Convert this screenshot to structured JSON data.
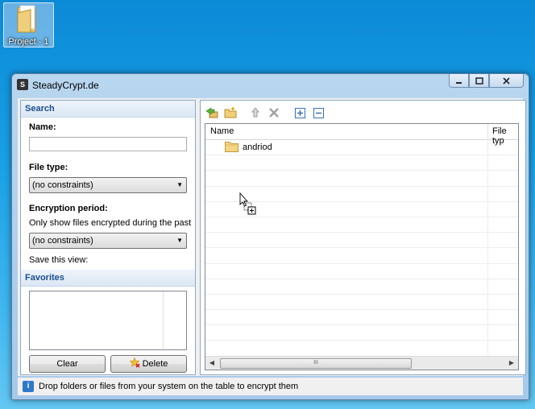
{
  "desktop": {
    "icon_label": "Project - 1"
  },
  "window": {
    "title": "SteadyCrypt.de",
    "app_icon_glyph": "S",
    "controls": {
      "minimize": "minimize-icon",
      "maximize": "maximize-icon",
      "close": "close-icon"
    }
  },
  "search": {
    "header": "Search",
    "name_label": "Name:",
    "name_value": "",
    "file_type_label": "File type:",
    "file_type_value": "(no constraints)",
    "encryption_label": "Encryption period:",
    "encryption_hint": "Only show files encrypted during the past",
    "encryption_value": "(no constraints)",
    "save_view_label": "Save this view:"
  },
  "favorites": {
    "header": "Favorites",
    "items": [],
    "clear_label": "Clear",
    "delete_label": "Delete"
  },
  "toolbar": {
    "icons": [
      "add-files-icon",
      "new-folder-icon",
      "move-up-icon",
      "delete-icon",
      "expand-all-icon",
      "collapse-all-icon"
    ]
  },
  "table": {
    "columns": [
      "Name",
      "File typ"
    ],
    "rows": [
      {
        "name": "andriod",
        "type": "folder"
      }
    ],
    "scroll_grip": "III"
  },
  "status": {
    "icon": "info-icon",
    "text": "Drop folders or files from your system on the table to encrypt them"
  }
}
